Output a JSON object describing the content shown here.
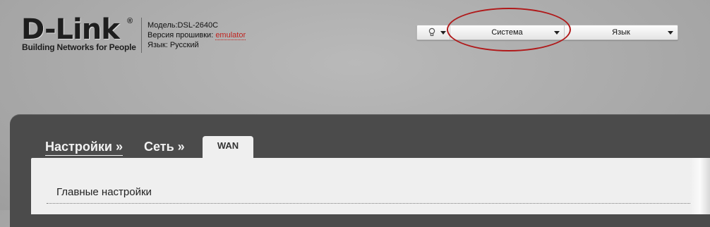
{
  "brand": {
    "logo_text": "D-Link",
    "registered_mark": "®",
    "tagline": "Building Networks for People"
  },
  "device_info": {
    "model_label": "Модель:",
    "model_value": "DSL-2640C",
    "firmware_label": "Версия прошивки:",
    "firmware_value": "emulator",
    "language_label": "Язык:",
    "language_value": "Русский"
  },
  "toolbar": {
    "hint_icon": "lightbulb-icon",
    "system_label": "Система",
    "language_label": "Язык"
  },
  "breadcrumb": {
    "item1": "Настройки »",
    "item2": "Сеть »"
  },
  "active_tab": "WAN",
  "section": {
    "title": "Главные настройки"
  },
  "colors": {
    "annotation_ellipse": "#b0191a",
    "firmware_link": "#c0231f",
    "panel": "#4b4b4b"
  }
}
